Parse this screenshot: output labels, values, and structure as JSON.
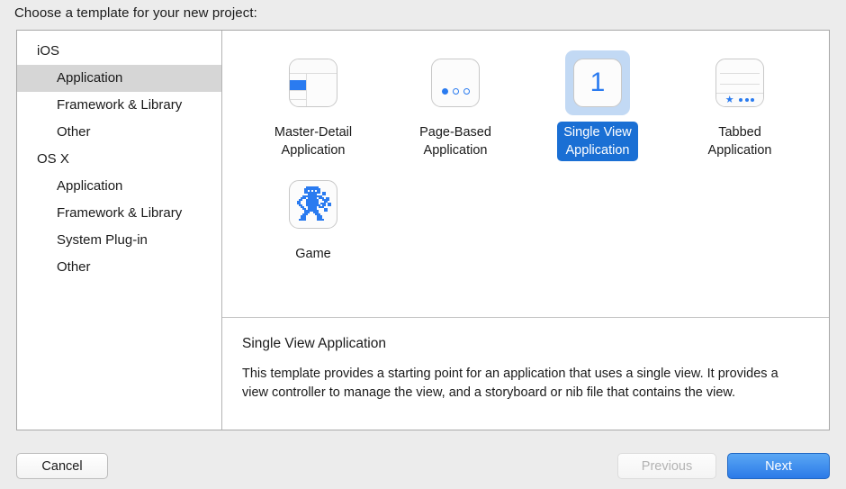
{
  "header": {
    "prompt": "Choose a template for your new project:"
  },
  "sidebar": {
    "groups": [
      {
        "label": "iOS",
        "items": [
          {
            "label": "Application",
            "selected": true
          },
          {
            "label": "Framework & Library",
            "selected": false
          },
          {
            "label": "Other",
            "selected": false
          }
        ]
      },
      {
        "label": "OS X",
        "items": [
          {
            "label": "Application",
            "selected": false
          },
          {
            "label": "Framework & Library",
            "selected": false
          },
          {
            "label": "System Plug-in",
            "selected": false
          },
          {
            "label": "Other",
            "selected": false
          }
        ]
      }
    ]
  },
  "templates": [
    {
      "label": "Master-Detail\nApplication",
      "icon": "master-detail-icon",
      "selected": false
    },
    {
      "label": "Page-Based\nApplication",
      "icon": "page-based-icon",
      "selected": false
    },
    {
      "label": "Single View\nApplication",
      "icon": "single-view-icon",
      "selected": true,
      "badge": "1"
    },
    {
      "label": "Tabbed\nApplication",
      "icon": "tabbed-icon",
      "selected": false
    },
    {
      "label": "Game",
      "icon": "game-robot-icon",
      "selected": false
    }
  ],
  "description": {
    "title": "Single View Application",
    "body": "This template provides a starting point for an application that uses a single view. It provides a view controller to manage the view, and a storyboard or nib file that contains the view."
  },
  "footer": {
    "cancel": "Cancel",
    "previous": "Previous",
    "next": "Next"
  },
  "colors": {
    "accent_blue": "#2a7bf0",
    "selection_blue": "#1a6fd4",
    "selection_halo": "#c2d9f4",
    "sidebar_selection_gray": "#d6d6d6",
    "window_background": "#ececec"
  }
}
